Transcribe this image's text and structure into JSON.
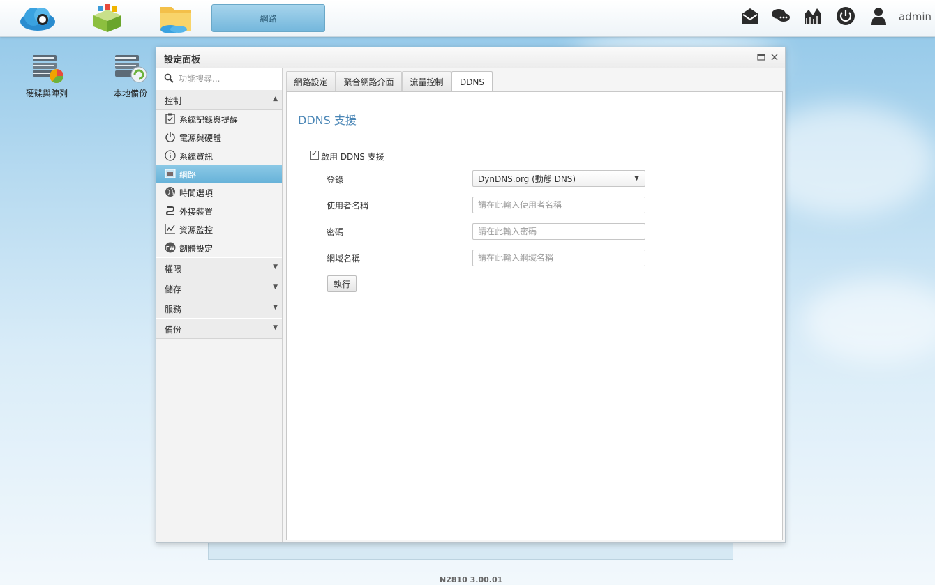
{
  "taskbar": {
    "running_task_label": "網路",
    "user_name": "admin"
  },
  "desktop": {
    "icons": [
      {
        "label": "硬碟與陣列"
      },
      {
        "label": "本地備份"
      }
    ]
  },
  "window": {
    "title": "設定面板"
  },
  "sidebar": {
    "search_placeholder": "功能搜尋...",
    "section_control": "控制",
    "items": [
      {
        "label": "系統記錄與提醒"
      },
      {
        "label": "電源與硬體"
      },
      {
        "label": "系統資訊"
      },
      {
        "label": "網路"
      },
      {
        "label": "時間選項"
      },
      {
        "label": "外接裝置"
      },
      {
        "label": "資源監控"
      },
      {
        "label": "韌體設定"
      }
    ],
    "collapsed_sections": [
      {
        "label": "權限"
      },
      {
        "label": "儲存"
      },
      {
        "label": "服務"
      },
      {
        "label": "備份"
      }
    ]
  },
  "tabs": [
    {
      "label": "網路設定"
    },
    {
      "label": "聚合網路介面"
    },
    {
      "label": "流量控制"
    },
    {
      "label": "DDNS"
    }
  ],
  "panel": {
    "title": "DDNS 支援",
    "enable_label": "啟用 DDNS 支援",
    "enable_checked": true,
    "register_label": "登錄",
    "register_value": "DynDNS.org (動態 DNS)",
    "username_label": "使用者名稱",
    "username_placeholder": "請在此輸入使用者名稱",
    "password_label": "密碼",
    "password_placeholder": "請在此輸入密碼",
    "domain_label": "網域名稱",
    "domain_placeholder": "請在此輸入網域名稱",
    "run_button": "執行"
  },
  "footer": {
    "version": "N2810   3.00.01"
  }
}
